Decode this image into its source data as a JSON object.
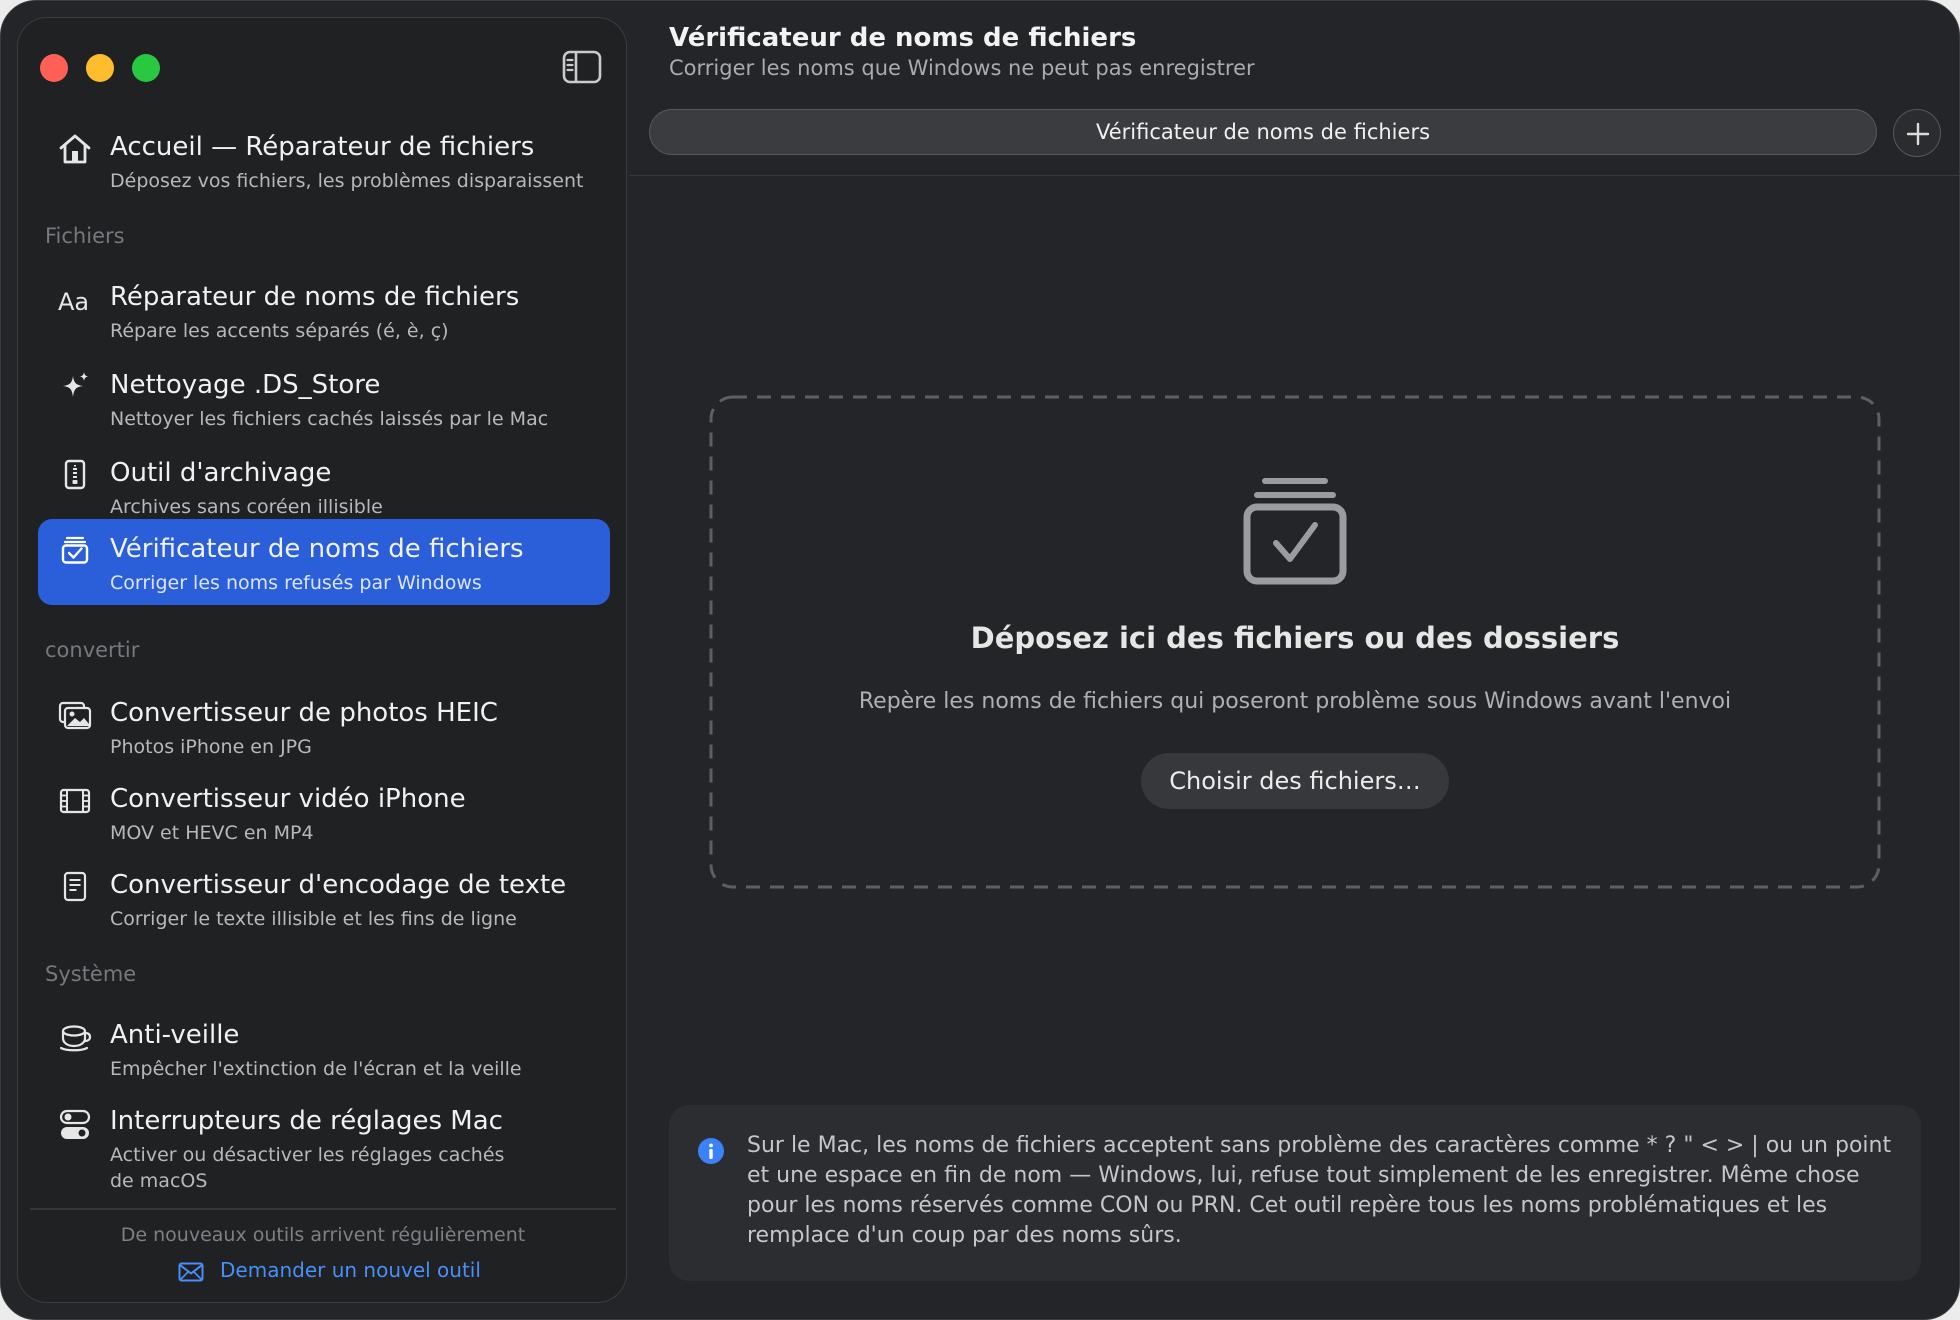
{
  "main": {
    "title": "Vérificateur de noms de fichiers",
    "subtitle": "Corriger les noms que Windows ne peut pas enregistrer",
    "tab_label": "Vérificateur de noms de fichiers",
    "drop_title": "Déposez ici des fichiers ou des dossiers",
    "drop_description": "Repère les noms de fichiers qui poseront problème sous Windows avant l'envoi",
    "choose_button": "Choisir des fichiers…",
    "info_text": "Sur le Mac, les noms de fichiers acceptent sans problème des caractères comme * ? \" < > | ou un point et une espace en fin de nom — Windows, lui, refuse tout simplement de les enregistrer. Même chose pour les noms réservés comme CON ou PRN. Cet outil repère tous les noms problématiques et les remplace d'un coup par des noms sûrs."
  },
  "sidebar": {
    "home": {
      "title": "Accueil — Réparateur de fichiers",
      "subtitle": "Déposez vos fichiers, les problèmes disparaissent",
      "icon": "house-icon"
    },
    "sections": [
      {
        "header": "Fichiers",
        "items": [
          {
            "title": "Réparateur de noms de fichiers",
            "subtitle": "Répare les accents séparés (é, è, ç)",
            "icon": "text-aa-icon"
          },
          {
            "title": "Nettoyage .DS_Store",
            "subtitle": "Nettoyer les fichiers cachés laissés par le Mac",
            "icon": "sparkles-icon"
          },
          {
            "title": "Outil d'archivage",
            "subtitle": "Archives sans coréen illisible",
            "icon": "zipper-file-icon"
          },
          {
            "title": "Vérificateur de noms de fichiers",
            "subtitle": "Corriger les noms refusés par Windows",
            "icon": "tray-checkmark-icon",
            "selected": true
          }
        ]
      },
      {
        "header": "convertir",
        "items": [
          {
            "title": "Convertisseur de photos HEIC",
            "subtitle": "Photos iPhone en JPG",
            "icon": "photos-icon"
          },
          {
            "title": "Convertisseur vidéo iPhone",
            "subtitle": "MOV et HEVC en MP4",
            "icon": "film-icon"
          },
          {
            "title": "Convertisseur d'encodage de texte",
            "subtitle": "Corriger le texte illisible et les fins de ligne",
            "icon": "document-text-icon"
          }
        ]
      },
      {
        "header": "Système",
        "items": [
          {
            "title": "Anti-veille",
            "subtitle": "Empêcher l'extinction de l'écran et la veille",
            "icon": "coffee-cup-icon"
          },
          {
            "title": "Interrupteurs de réglages Mac",
            "subtitle": "Activer ou désactiver les réglages cachés de macOS",
            "icon": "switches-icon"
          }
        ]
      }
    ],
    "footer_text": "De nouveaux outils arrivent régulièrement",
    "footer_link": "Demander un nouvel outil"
  },
  "colors": {
    "accent": "#2b5fd9",
    "link": "#4a8ef7",
    "close": "#ff5f57",
    "minimize": "#febc2e",
    "zoom": "#28c840"
  }
}
